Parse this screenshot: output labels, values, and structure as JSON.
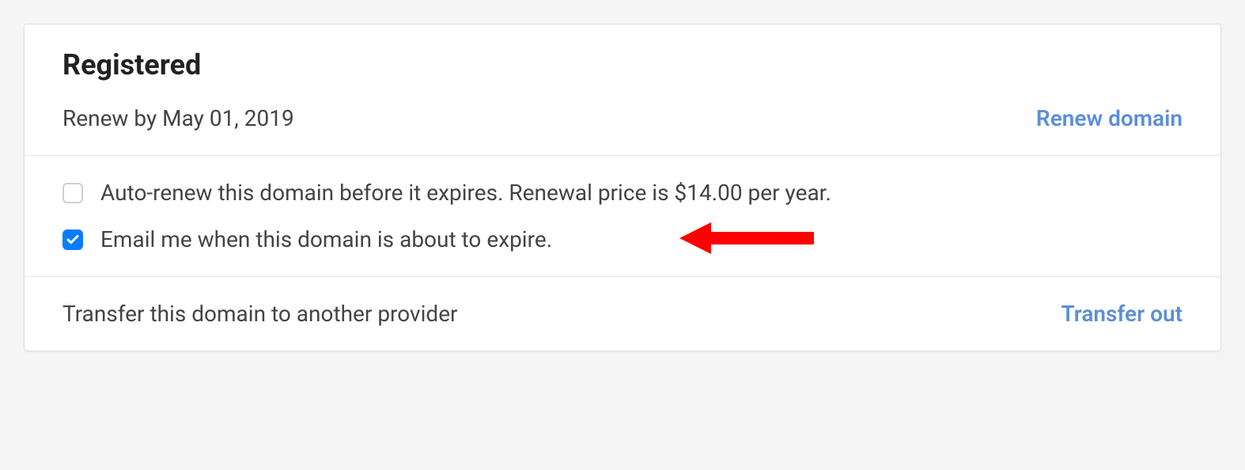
{
  "card": {
    "title": "Registered",
    "renew_by_text": "Renew by May 01, 2019",
    "renew_action": "Renew domain",
    "auto_renew_label": "Auto-renew this domain before it expires. Renewal price is $14.00 per year.",
    "auto_renew_checked": false,
    "email_expire_label": "Email me when this domain is about to expire.",
    "email_expire_checked": true,
    "transfer_text": "Transfer this domain to another provider",
    "transfer_action": "Transfer out"
  },
  "colors": {
    "link": "#5b8fd8",
    "checkbox_fill": "#0a7cff",
    "annotation": "#ff0000"
  }
}
